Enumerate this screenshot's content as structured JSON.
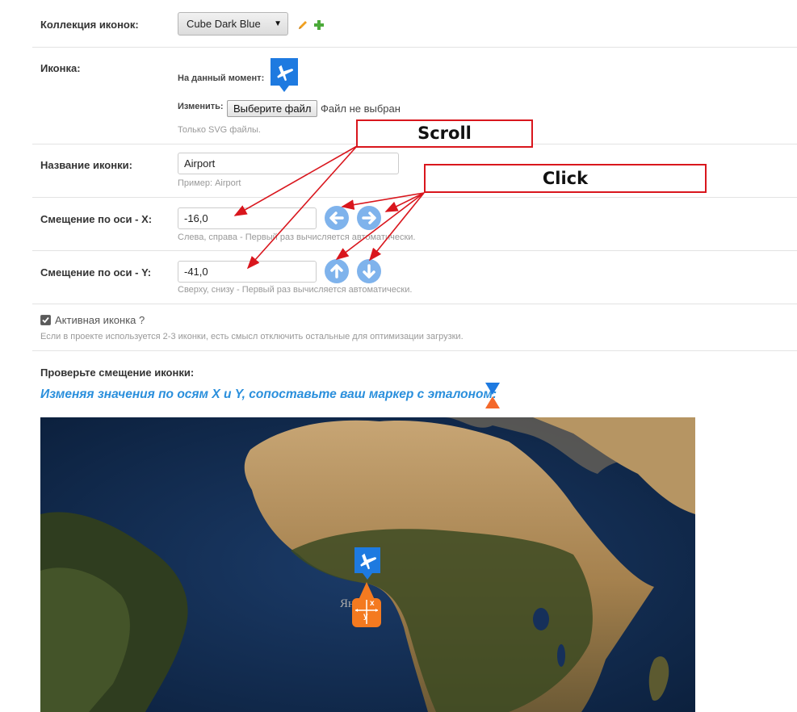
{
  "collection": {
    "label": "Коллекция иконок:",
    "selected": "Cube Dark Blue",
    "edit_icon": "pencil-icon",
    "add_icon": "plus-icon"
  },
  "icon": {
    "label": "Иконка:",
    "current_label": "На данный момент:",
    "change_label": "Изменить:",
    "file_button": "Выберите файл",
    "file_status": "Файл не выбран",
    "help": "Только SVG файлы.",
    "preview_icon": "airplane-marker-icon"
  },
  "name": {
    "label": "Название иконки:",
    "value": "Airport",
    "help": "Пример: Airport"
  },
  "offset_x": {
    "label": "Смещение по оси - X:",
    "value": "-16,0",
    "help": "Слева, справа - Первый раз вычисляется автоматически."
  },
  "offset_y": {
    "label": "Смещение по оси - Y:",
    "value": "-41,0",
    "help": "Сверху, снизу - Первый раз вычисляется автоматически."
  },
  "active": {
    "label": "Активная иконка ?",
    "checked": true,
    "help": "Если в проекте используется 2-3 иконки, есть смысл отключить остальные для оптимизации загрузки."
  },
  "check": {
    "label": "Проверьте смещение иконки:",
    "instruction": "Изменяя значения по осям X и Y, сопоставьте ваш маркер с эталоном:",
    "reference_icon": "hourglass-reference-icon"
  },
  "map": {
    "marker_x_label": "x",
    "marker_y_label": "y",
    "watermark": "Ян"
  },
  "annotations": {
    "scroll": "Scroll",
    "click": "Click"
  },
  "colors": {
    "accent_blue": "#1e7ae0",
    "button_blue": "#7fb3ec",
    "annotation_red": "#d9161d",
    "marker_orange": "#f47a20",
    "instruction_blue": "#2a8fdc"
  }
}
